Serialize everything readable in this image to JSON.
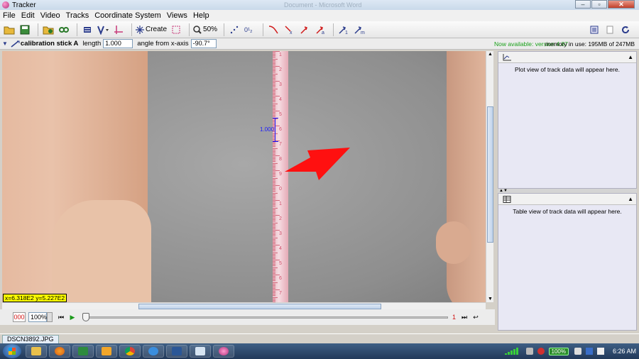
{
  "window": {
    "title": "Tracker",
    "background_title": "Document - Microsoft Word"
  },
  "menu": [
    "File",
    "Edit",
    "Video",
    "Tracks",
    "Coordinate System",
    "Views",
    "Help"
  ],
  "toolbar": {
    "create_label": "Create",
    "zoom_label": "50%"
  },
  "propbar": {
    "track_name": "calibration stick A",
    "length_label": "length",
    "length_value": "1.000",
    "angle_label": "angle from x-axis",
    "angle_value": "-90.7°",
    "update_notice": "Now available: version 4.87",
    "memory": "memory in use: 195MB of 247MB"
  },
  "video": {
    "calibration_value": "1.000",
    "coordinate_readout": "x=6.318E2  y=5.227E2",
    "ruler_numbers": [
      "1",
      "2",
      "3",
      "4",
      "5",
      "6",
      "7",
      "8",
      "9",
      "0",
      "1",
      "2",
      "3",
      "4",
      "5",
      "6",
      "7"
    ]
  },
  "playback": {
    "frame": "000",
    "rate": "100%",
    "end_frame": "1",
    "position_fraction": 0
  },
  "panels": {
    "plot_message": "Plot view of track data will appear here.",
    "table_message": "Table view of track data will appear here."
  },
  "file_tab": "DSCN3892.JPG",
  "taskbar": {
    "battery": "100%",
    "clock": "6:26 AM"
  },
  "colors": {
    "accent": "#1a1aff",
    "arrow": "#ff0000",
    "coord_bg": "#ffff00",
    "notice": "#19a019"
  }
}
